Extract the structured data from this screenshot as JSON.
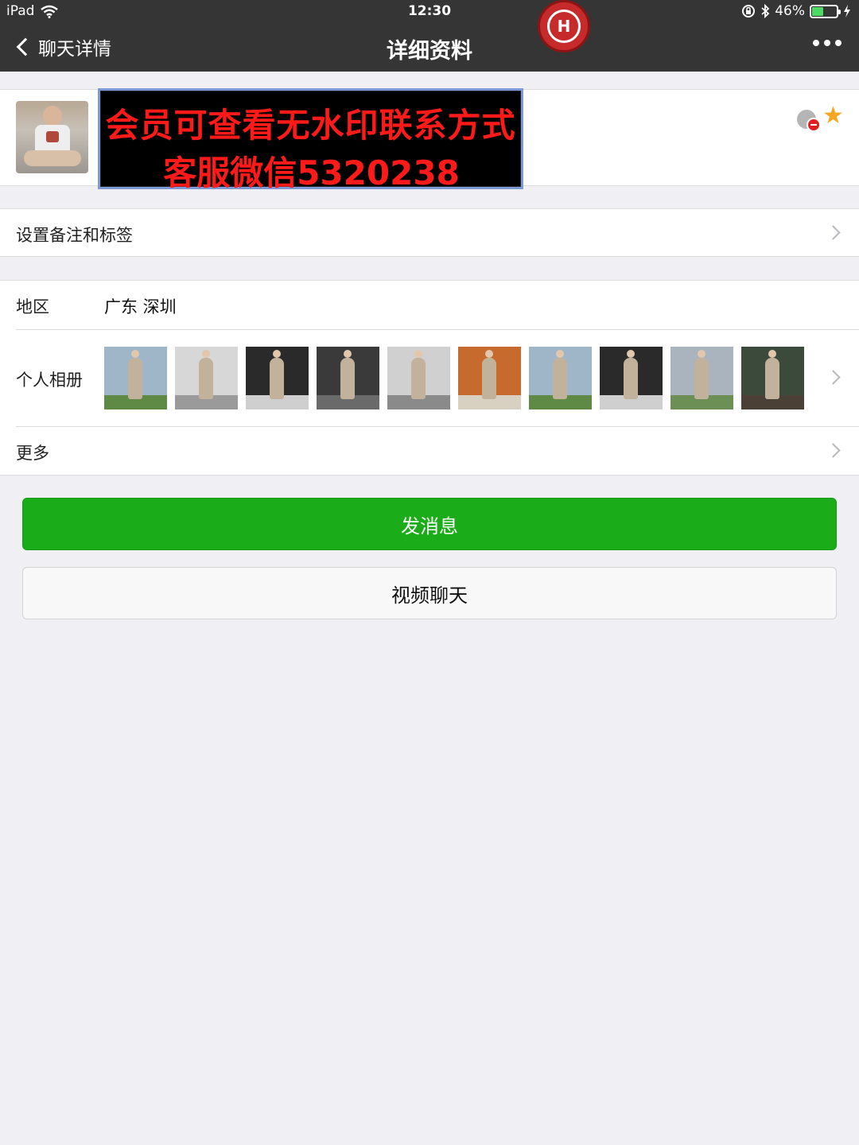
{
  "status_bar": {
    "device": "iPad",
    "time": "12:30",
    "battery_text": "46%",
    "battery_level": 0.46,
    "icons": [
      "wifi-icon",
      "orientation-lock-icon",
      "bluetooth-icon",
      "battery-icon",
      "charging-icon"
    ]
  },
  "nav": {
    "back_label": "聊天详情",
    "title": "详细资料"
  },
  "watermark": {
    "banner_line1": "会员可查看无水印联系方式",
    "banner_line2": "客服微信5320238"
  },
  "profile": {
    "icons": [
      "block-icon",
      "star-icon"
    ],
    "star_color": "#f5a623"
  },
  "cells": {
    "remark_label": "设置备注和标签",
    "region_label": "地区",
    "region_value": "广东 深圳",
    "album_label": "个人相册",
    "more_label": "更多"
  },
  "album": {
    "photo_count": 10
  },
  "buttons": {
    "send_message": "发消息",
    "video_chat": "视频聊天"
  },
  "colors": {
    "nav_bg": "#353535",
    "primary_green": "#1aad19",
    "page_bg": "#efeff4",
    "banner_text": "#ff1a1a"
  }
}
